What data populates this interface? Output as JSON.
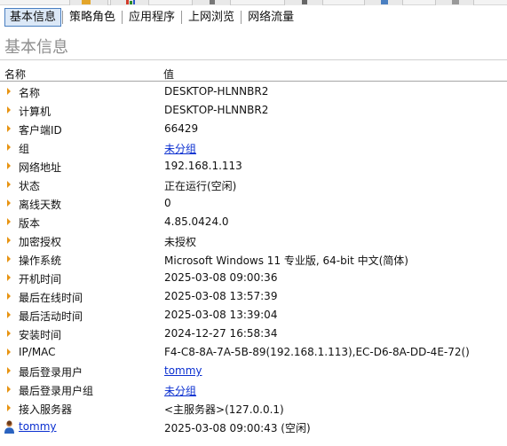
{
  "tabs": [
    {
      "label": "基本信息",
      "active": true
    },
    {
      "label": "策略角色",
      "active": false
    },
    {
      "label": "应用程序",
      "active": false
    },
    {
      "label": "上网浏览",
      "active": false
    },
    {
      "label": "网络流量",
      "active": false
    }
  ],
  "section_title": "基本信息",
  "columns": {
    "name": "名称",
    "value": "值"
  },
  "rows": [
    {
      "label": "名称",
      "value": "DESKTOP-HLNNBR2",
      "link": false
    },
    {
      "label": "计算机",
      "value": "DESKTOP-HLNNBR2",
      "link": false
    },
    {
      "label": "客户端ID",
      "value": "66429",
      "link": false
    },
    {
      "label": "组",
      "value": "未分组",
      "link": true
    },
    {
      "label": "网络地址",
      "value": "192.168.1.113",
      "link": false
    },
    {
      "label": "状态",
      "value": "正在运行(空闲)",
      "link": false
    },
    {
      "label": "离线天数",
      "value": "0",
      "link": false
    },
    {
      "label": "版本",
      "value": "4.85.0424.0",
      "link": false
    },
    {
      "label": "加密授权",
      "value": "未授权",
      "link": false
    },
    {
      "label": "操作系统",
      "value": "Microsoft Windows 11 专业版, 64-bit 中文(简体)",
      "link": false
    },
    {
      "label": "开机时间",
      "value": "2025-03-08 09:00:36",
      "link": false
    },
    {
      "label": "最后在线时间",
      "value": "2025-03-08 13:57:39",
      "link": false
    },
    {
      "label": "最后活动时间",
      "value": "2025-03-08 13:39:04",
      "link": false
    },
    {
      "label": "安装时间",
      "value": "2024-12-27 16:58:34",
      "link": false
    },
    {
      "label": "IP/MAC",
      "value": "F4-C8-8A-7A-5B-89(192.168.1.113),EC-D6-8A-DD-4E-72()",
      "link": false
    },
    {
      "label": "最后登录用户",
      "value": "tommy",
      "link": true
    },
    {
      "label": "最后登录用户组",
      "value": "未分组",
      "link": true
    },
    {
      "label": "接入服务器",
      "value": "<主服务器>(127.0.0.1)",
      "link": false
    }
  ],
  "user_row": {
    "label": "tommy",
    "value": "2025-03-08 09:00:43 (空闲)"
  },
  "icons": {
    "row_marker": "orange-triangle-icon",
    "user": "user-icon"
  },
  "colors": {
    "accent": "#e89412",
    "link": "#0a2fd0",
    "tab_active_border": "#4a7fc1",
    "tab_active_bg": "#dbe8f7"
  }
}
